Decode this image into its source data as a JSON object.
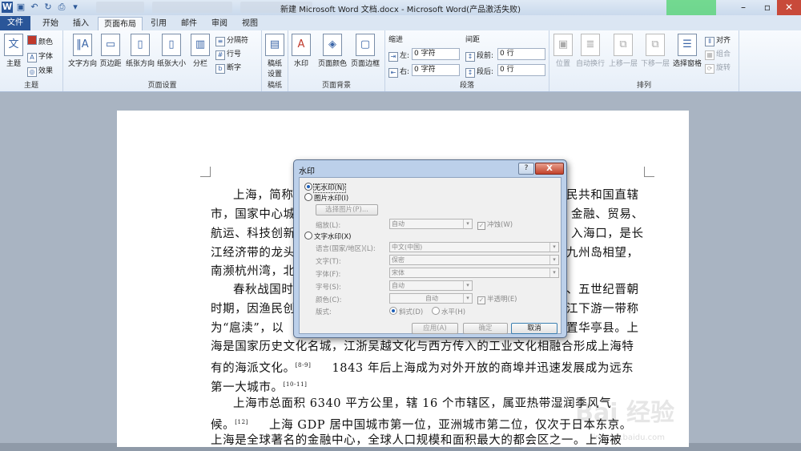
{
  "window": {
    "title": "新建 Microsoft Word 文档.docx - Microsoft Word(产品激活失败)",
    "minimize": "–",
    "restore": "▫",
    "close": "✕"
  },
  "ribbon_tabs": [
    "文件",
    "开始",
    "插入",
    "页面布局",
    "引用",
    "邮件",
    "审阅",
    "视图"
  ],
  "ribbon": {
    "theme": {
      "big": "主题",
      "colors": "颜色",
      "fonts": "字体",
      "effects": "效果",
      "group": "主题"
    },
    "page_setup": {
      "text_dir": "文字方向",
      "margins": "页边距",
      "orientation": "纸张方向",
      "size": "纸张大小",
      "columns": "分栏",
      "breaks": "分隔符",
      "line_numbers": "行号",
      "hyphenation": "断字",
      "group": "页面设置"
    },
    "draft": {
      "big": "稿纸\n设置",
      "group": "稿纸"
    },
    "page_bg": {
      "watermark": "水印",
      "page_color": "页面颜色",
      "page_border": "页面边框",
      "group": "页面背景"
    },
    "paragraph": {
      "indent_title": "缩进",
      "spacing_title": "间距",
      "left_label": "左:",
      "left_value": "0 字符",
      "right_label": "右:",
      "right_value": "0 字符",
      "before_label": "段前:",
      "before_value": "0 行",
      "after_label": "段后:",
      "after_value": "0 行",
      "group": "段落"
    },
    "arrange": {
      "position": "位置",
      "wrap": "自动换行",
      "forward": "上移一层",
      "backward": "下移一层",
      "selection": "选择窗格",
      "align": "对齐",
      "group_btn": "组合",
      "rotate": "旋转",
      "group": "排列"
    }
  },
  "document": {
    "paragraphs": [
      "上海，简称",
      "市，国家中心城",
      "航运、科技创新",
      "江经济带的龙头",
      "南濒杭州湾，北",
      "春秋战国时",
      "时期，因渔民创",
      "为“扈渎”，以",
      "海是国家历史文化名城，江浙吴越文化与西方传入的工业文化相融合形成上海特",
      "有的海派文化。",
      "第一大城市。",
      "上海市总面积 6340 平方公里，辖 16 个市辖区，属亚热带湿润季风气",
      "候。",
      "上海是全球著名的金融中心，全球人口规模和面积最大的都会区之一。上海被"
    ],
    "right_fragments": [
      "民共和国直辖",
      "金融、贸易、",
      "入海口，是长",
      "九州岛相望，",
      "、五世纪晋朝",
      "江下游一带称",
      "置华亭县。上"
    ],
    "para10_rest": "1843 年后上海成为对外开放的商埠并迅速发展成为远东",
    "para12_rest": "上海 GDP 居中国城市第一位，亚洲城市第二位，仅次于日本东京。",
    "ref_8_9": "[8-9]",
    "ref_10_11": "[10-11]",
    "ref_12": "[12]"
  },
  "watermark_site": {
    "logo": "Bai 经验",
    "url": "jingyan.baidu.com"
  },
  "dialog": {
    "title": "水印",
    "help": "?",
    "close": "X",
    "no_watermark": "无水印(N)",
    "picture_watermark": "图片水印(I)",
    "select_picture": "选择图片(P)...",
    "scale_label": "缩放(L):",
    "scale_value": "自动",
    "washout": "冲蚀(W)",
    "text_watermark": "文字水印(X)",
    "language_label": "语言(国家/地区)(L):",
    "language_value": "中文(中国)",
    "text_label": "文字(T):",
    "text_value": "保密",
    "font_label": "字体(F):",
    "font_value": "宋体",
    "size_label": "字号(S):",
    "size_value": "自动",
    "color_label": "颜色(C):",
    "color_value": "自动",
    "semitransparent": "半透明(E)",
    "layout_label": "版式:",
    "diagonal": "斜式(D)",
    "horizontal": "水平(H)",
    "apply": "应用(A)",
    "ok": "确定",
    "cancel": "取消"
  }
}
